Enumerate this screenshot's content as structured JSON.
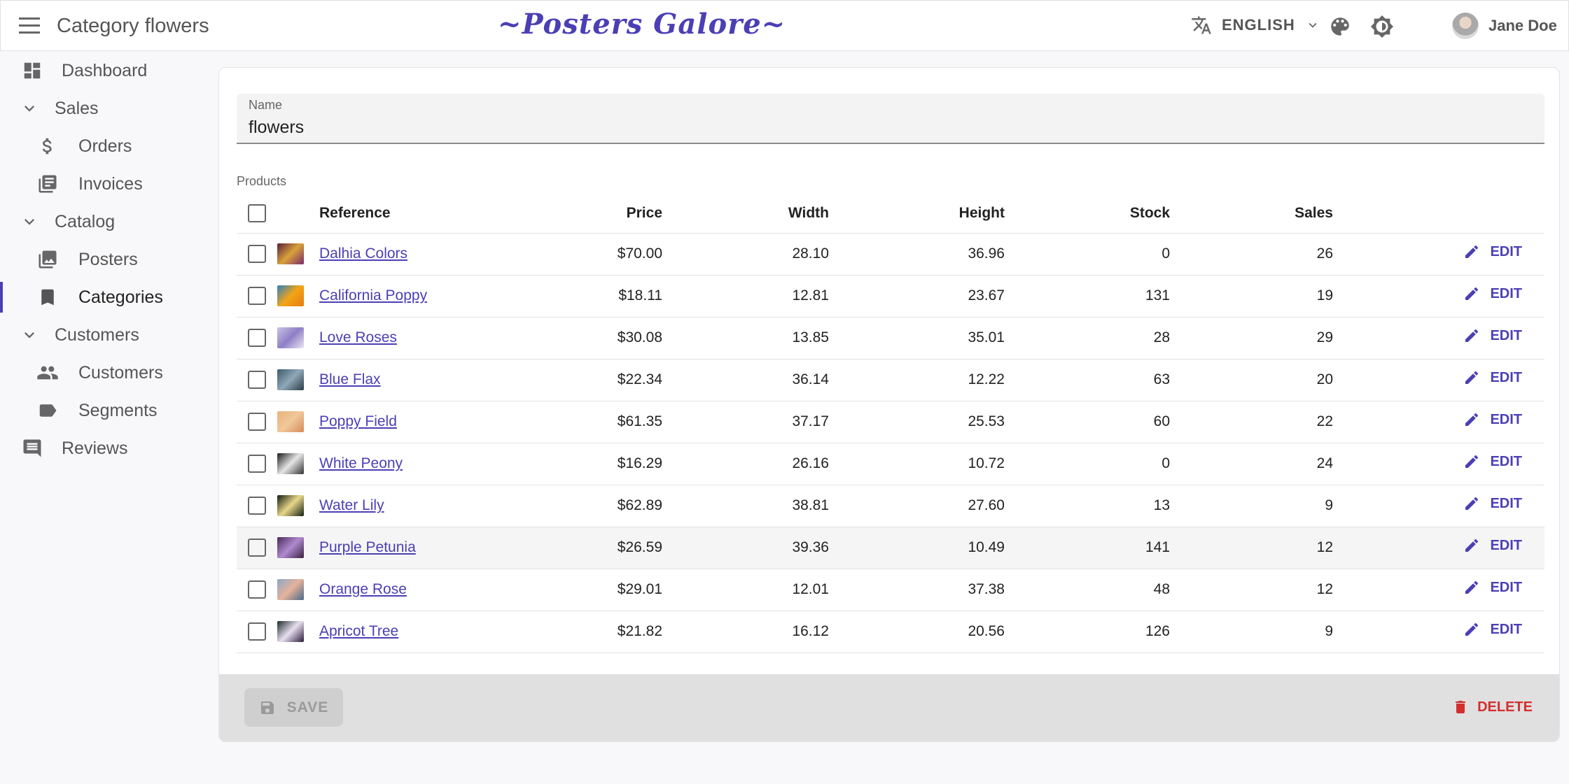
{
  "header": {
    "title": "Category flowers",
    "brand": "~Posters Galore~",
    "language": "ENGLISH",
    "user_name": "Jane Doe"
  },
  "sidebar": {
    "items": [
      {
        "label": "Dashboard",
        "icon": "dashboard-icon"
      },
      {
        "label": "Sales",
        "icon": "chevron-down-icon"
      },
      {
        "label": "Orders",
        "icon": "dollar-icon"
      },
      {
        "label": "Invoices",
        "icon": "invoices-icon"
      },
      {
        "label": "Catalog",
        "icon": "chevron-down-icon"
      },
      {
        "label": "Posters",
        "icon": "image-icon"
      },
      {
        "label": "Categories",
        "icon": "bookmark-icon"
      },
      {
        "label": "Customers",
        "icon": "chevron-down-icon"
      },
      {
        "label": "Customers",
        "icon": "people-icon"
      },
      {
        "label": "Segments",
        "icon": "label-icon"
      },
      {
        "label": "Reviews",
        "icon": "comment-icon"
      }
    ]
  },
  "form": {
    "name_label": "Name",
    "name_value": "flowers",
    "products_label": "Products"
  },
  "table": {
    "headers": [
      "Reference",
      "Price",
      "Width",
      "Height",
      "Stock",
      "Sales"
    ],
    "edit_label": "EDIT",
    "rows": [
      {
        "reference": "Dalhia Colors",
        "price": "$70.00",
        "width": "28.10",
        "height": "36.96",
        "stock": "0",
        "sales": "26"
      },
      {
        "reference": "California Poppy",
        "price": "$18.11",
        "width": "12.81",
        "height": "23.67",
        "stock": "131",
        "sales": "19"
      },
      {
        "reference": "Love Roses",
        "price": "$30.08",
        "width": "13.85",
        "height": "35.01",
        "stock": "28",
        "sales": "29"
      },
      {
        "reference": "Blue Flax",
        "price": "$22.34",
        "width": "36.14",
        "height": "12.22",
        "stock": "63",
        "sales": "20"
      },
      {
        "reference": "Poppy Field",
        "price": "$61.35",
        "width": "37.17",
        "height": "25.53",
        "stock": "60",
        "sales": "22"
      },
      {
        "reference": "White Peony",
        "price": "$16.29",
        "width": "26.16",
        "height": "10.72",
        "stock": "0",
        "sales": "24"
      },
      {
        "reference": "Water Lily",
        "price": "$62.89",
        "width": "38.81",
        "height": "27.60",
        "stock": "13",
        "sales": "9"
      },
      {
        "reference": "Purple Petunia",
        "price": "$26.59",
        "width": "39.36",
        "height": "10.49",
        "stock": "141",
        "sales": "12"
      },
      {
        "reference": "Orange Rose",
        "price": "$29.01",
        "width": "12.01",
        "height": "37.38",
        "stock": "48",
        "sales": "12"
      },
      {
        "reference": "Apricot Tree",
        "price": "$21.82",
        "width": "16.12",
        "height": "20.56",
        "stock": "126",
        "sales": "9"
      }
    ]
  },
  "toolbar": {
    "save_label": "SAVE",
    "delete_label": "DELETE"
  },
  "colors": {
    "accent": "#4b3fb5",
    "danger": "#d32f2f"
  }
}
